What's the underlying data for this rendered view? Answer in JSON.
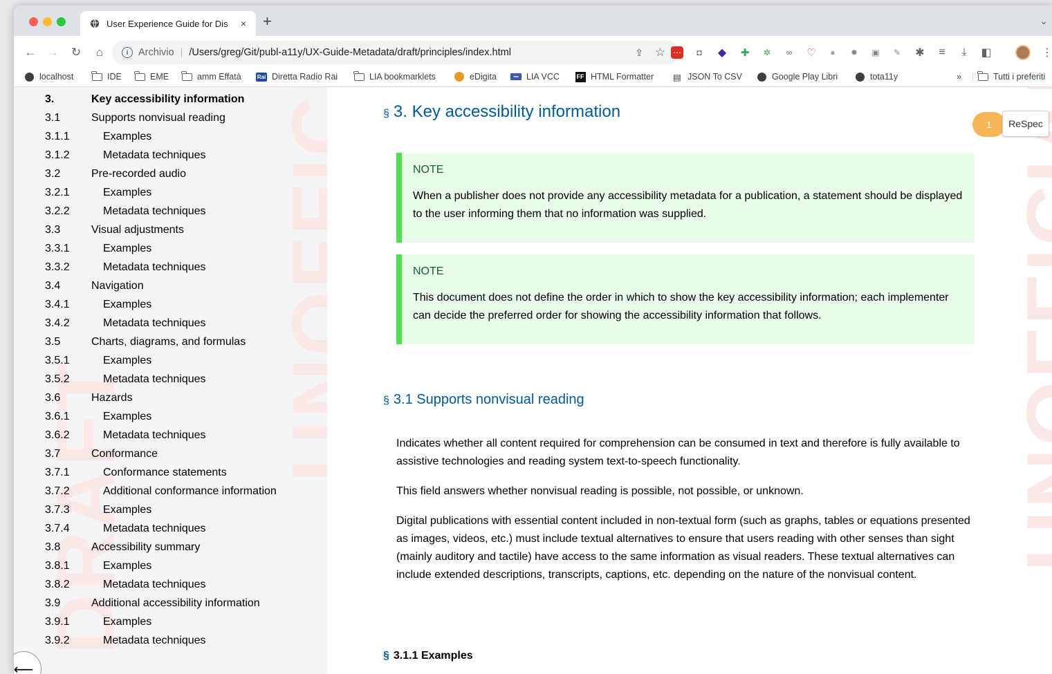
{
  "browser": {
    "tab_title": "User Experience Guide for Dis",
    "tab_close": "×",
    "new_tab": "+",
    "tab_menu": "⌄",
    "scheme_label": "Archivio",
    "url": "/Users/greg/Git/publ-a11y/UX-Guide-Metadata/draft/principles/index.html"
  },
  "bookmarks": [
    {
      "label": "localhost",
      "icon": "globe-icon"
    },
    {
      "label": "IDE",
      "icon": "folder-icon"
    },
    {
      "label": "EME",
      "icon": "folder-icon"
    },
    {
      "label": "amm Effatà",
      "icon": "folder-icon"
    },
    {
      "label": "Diretta Radio Rai",
      "icon": "rai-icon",
      "icon_text": "Rai"
    },
    {
      "label": "LIA bookmarklets",
      "icon": "folder-icon"
    },
    {
      "label": "eDigita",
      "icon": "edigita-icon"
    },
    {
      "label": "LIA VCC",
      "icon": "lia-icon"
    },
    {
      "label": "HTML Formatter",
      "icon": "ff-icon",
      "icon_text": "FF"
    },
    {
      "label": "JSON To CSV",
      "icon": "json-icon"
    },
    {
      "label": "Google Play Libri",
      "icon": "globe-icon"
    },
    {
      "label": "tota11y",
      "icon": "globe-icon"
    }
  ],
  "bookmarks_overflow": "»",
  "bookmarks_all": "Tutti i preferiti",
  "toc": [
    {
      "num": "3.",
      "label": "Key accessibility information",
      "level": "top"
    },
    {
      "num": "3.1",
      "label": "Supports nonvisual reading",
      "level": "l2"
    },
    {
      "num": "3.1.1",
      "label": "Examples",
      "level": "l3"
    },
    {
      "num": "3.1.2",
      "label": "Metadata techniques",
      "level": "l3"
    },
    {
      "num": "3.2",
      "label": "Pre-recorded audio",
      "level": "l2"
    },
    {
      "num": "3.2.1",
      "label": "Examples",
      "level": "l3"
    },
    {
      "num": "3.2.2",
      "label": "Metadata techniques",
      "level": "l3"
    },
    {
      "num": "3.3",
      "label": "Visual adjustments",
      "level": "l2"
    },
    {
      "num": "3.3.1",
      "label": "Examples",
      "level": "l3"
    },
    {
      "num": "3.3.2",
      "label": "Metadata techniques",
      "level": "l3"
    },
    {
      "num": "3.4",
      "label": "Navigation",
      "level": "l2"
    },
    {
      "num": "3.4.1",
      "label": "Examples",
      "level": "l3"
    },
    {
      "num": "3.4.2",
      "label": "Metadata techniques",
      "level": "l3"
    },
    {
      "num": "3.5",
      "label": "Charts, diagrams, and formulas",
      "level": "l2"
    },
    {
      "num": "3.5.1",
      "label": "Examples",
      "level": "l3"
    },
    {
      "num": "3.5.2",
      "label": "Metadata techniques",
      "level": "l3"
    },
    {
      "num": "3.6",
      "label": "Hazards",
      "level": "l2"
    },
    {
      "num": "3.6.1",
      "label": "Examples",
      "level": "l3"
    },
    {
      "num": "3.6.2",
      "label": "Metadata techniques",
      "level": "l3"
    },
    {
      "num": "3.7",
      "label": "Conformance",
      "level": "l2"
    },
    {
      "num": "3.7.1",
      "label": "Conformance statements",
      "level": "l3"
    },
    {
      "num": "3.7.2",
      "label": "Additional conformance information",
      "level": "l3"
    },
    {
      "num": "3.7.3",
      "label": "Examples",
      "level": "l3"
    },
    {
      "num": "3.7.4",
      "label": "Metadata techniques",
      "level": "l3"
    },
    {
      "num": "3.8",
      "label": "Accessibility summary",
      "level": "l2"
    },
    {
      "num": "3.8.1",
      "label": "Examples",
      "level": "l3"
    },
    {
      "num": "3.8.2",
      "label": "Metadata techniques",
      "level": "l3"
    },
    {
      "num": "3.9",
      "label": "Additional accessibility information",
      "level": "l2"
    },
    {
      "num": "3.9.1",
      "label": "Examples",
      "level": "l3"
    },
    {
      "num": "3.9.2",
      "label": "Metadata techniques",
      "level": "l3"
    }
  ],
  "watermark": {
    "draft": "DRAFT",
    "unofficial": "UNOFFICIAL"
  },
  "content": {
    "section_mark": "§",
    "h2": "3. Key accessibility information",
    "note_label": "NOTE",
    "note1": "When a publisher does not provide any accessibility metadata for a publication, a statement should be displayed to the user informing them that no information was supplied.",
    "note2": "This document does not define the order in which to show the key accessibility information; each implementer can decide the preferred order for showing the accessibility information that follows.",
    "h3": "3.1 Supports nonvisual reading",
    "p1": "Indicates whether all content required for comprehension can be consumed in text and therefore is fully available to assistive technologies and reading system text-to-speech functionality.",
    "p2": "This field answers whether nonvisual reading is possible, not possible, or unknown.",
    "p3": "Digital publications with essential content included in non-textual form (such as graphs, tables or equations presented as images, videos, etc.) must include textual alternatives to ensure that users reading with other senses than sight (mainly auditory and tactile) have access to the same information as visual readers. These textual alternatives can include extended descriptions, transcripts, captions, etc. depending on the nature of the nonvisual content.",
    "h4": "3.1.1 Examples"
  },
  "respec": {
    "count": "1",
    "label": "ReSpec"
  }
}
